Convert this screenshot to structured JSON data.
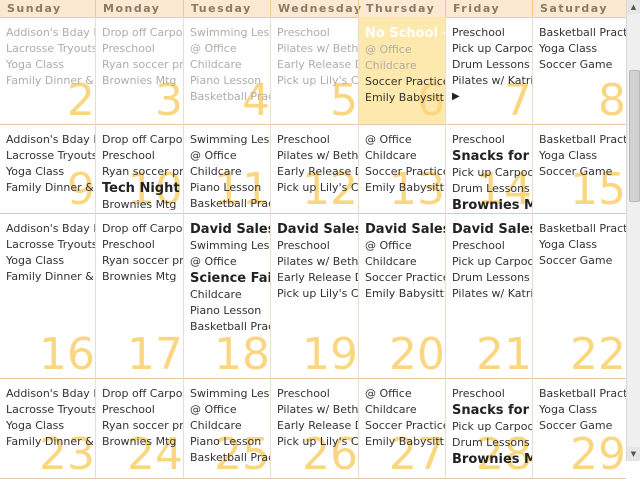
{
  "days_of_week": [
    "Sunday",
    "Monday",
    "Tuesday",
    "Wednesday",
    "Thursday",
    "Friday",
    "Saturday"
  ],
  "weeks": [
    {
      "days": [
        {
          "num": "2",
          "events": [
            {
              "text": "Addison's Bday P",
              "style": "past"
            },
            {
              "text": "Lacrosse Tryouts",
              "style": "past"
            },
            {
              "text": "Yoga Class",
              "style": "past"
            },
            {
              "text": "Family Dinner & M",
              "style": "past"
            }
          ]
        },
        {
          "num": "3",
          "events": [
            {
              "text": "Drop off Carpool",
              "style": "past"
            },
            {
              "text": "Preschool",
              "style": "past"
            },
            {
              "text": "Ryan soccer pra",
              "style": "past"
            },
            {
              "text": "Brownies Mtg",
              "style": "past"
            }
          ]
        },
        {
          "num": "4",
          "events": [
            {
              "text": "Swimming Lesso",
              "style": "past"
            },
            {
              "text": "@ Office",
              "style": "past"
            },
            {
              "text": "Childcare",
              "style": "past"
            },
            {
              "text": "Piano Lesson",
              "style": "past"
            },
            {
              "text": "Basketball Pract",
              "style": "past"
            }
          ]
        },
        {
          "num": "5",
          "events": [
            {
              "text": "Preschool",
              "style": "past"
            },
            {
              "text": "Pilates w/ Beth",
              "style": "past"
            },
            {
              "text": "Early Release D",
              "style": "past"
            },
            {
              "text": "Pick up Lily's Ca",
              "style": "past"
            }
          ]
        },
        {
          "num": "6",
          "today": true,
          "events": [
            {
              "text": "No School - ",
              "style": "bigwhite"
            },
            {
              "text": "@ Office",
              "style": "past"
            },
            {
              "text": "Childcare",
              "style": "past"
            },
            {
              "text": "Soccer Practice",
              "style": "normal"
            },
            {
              "text": "Emily Babysittin",
              "style": "normal"
            }
          ]
        },
        {
          "num": "7",
          "more": "▶",
          "events": [
            {
              "text": "Preschool",
              "style": "normal"
            },
            {
              "text": "Pick up Carpool",
              "style": "normal"
            },
            {
              "text": "Drum Lessons",
              "style": "normal"
            },
            {
              "text": "Pilates w/ Katrin",
              "style": "normal"
            }
          ]
        },
        {
          "num": "8",
          "events": [
            {
              "text": "Basketball Practic",
              "style": "normal"
            },
            {
              "text": "Yoga Class",
              "style": "normal"
            },
            {
              "text": "Soccer Game",
              "style": "normal"
            }
          ]
        }
      ]
    },
    {
      "days": [
        {
          "num": "9",
          "events": [
            {
              "text": "Addison's Bday P",
              "style": "normal"
            },
            {
              "text": "Lacrosse Tryouts",
              "style": "normal"
            },
            {
              "text": "Yoga Class",
              "style": "normal"
            },
            {
              "text": "Family Dinner & M",
              "style": "normal"
            }
          ]
        },
        {
          "num": "10",
          "events": [
            {
              "text": "Drop off Carpool",
              "style": "normal"
            },
            {
              "text": "Preschool",
              "style": "normal"
            },
            {
              "text": "Ryan soccer pra",
              "style": "normal"
            },
            {
              "text": "Tech Night",
              "style": "big"
            },
            {
              "text": "Brownies Mtg",
              "style": "normal"
            }
          ]
        },
        {
          "num": "11",
          "events": [
            {
              "text": "Swimming Lesso",
              "style": "normal"
            },
            {
              "text": "@ Office",
              "style": "normal"
            },
            {
              "text": "Childcare",
              "style": "normal"
            },
            {
              "text": "Piano Lesson",
              "style": "normal"
            },
            {
              "text": "Basketball Pract",
              "style": "normal"
            }
          ]
        },
        {
          "num": "12",
          "events": [
            {
              "text": "Preschool",
              "style": "normal"
            },
            {
              "text": "Pilates w/ Beth",
              "style": "normal"
            },
            {
              "text": "Early Release D",
              "style": "normal"
            },
            {
              "text": "Pick up Lily's Ca",
              "style": "normal"
            }
          ]
        },
        {
          "num": "13",
          "events": [
            {
              "text": "@ Office",
              "style": "normal"
            },
            {
              "text": "Childcare",
              "style": "normal"
            },
            {
              "text": "Soccer Practice",
              "style": "normal"
            },
            {
              "text": "Emily Babysittin",
              "style": "normal"
            }
          ]
        },
        {
          "num": "14",
          "events": [
            {
              "text": "Preschool",
              "style": "normal"
            },
            {
              "text": "Snacks for E",
              "style": "big"
            },
            {
              "text": "Pick up Carpool",
              "style": "normal"
            },
            {
              "text": "Drum Lessons",
              "style": "normal"
            },
            {
              "text": "Brownies Mtg",
              "style": "big"
            },
            {
              "text": "Pilates w/ Katrin",
              "style": "normal"
            }
          ]
        },
        {
          "num": "15",
          "events": [
            {
              "text": "Basketball Practic",
              "style": "normal"
            },
            {
              "text": "Yoga Class",
              "style": "normal"
            },
            {
              "text": "Soccer Game",
              "style": "normal"
            }
          ]
        }
      ]
    },
    {
      "days": [
        {
          "num": "16",
          "events": [
            {
              "text": "Addison's Bday P",
              "style": "normal"
            },
            {
              "text": "Lacrosse Tryouts",
              "style": "normal"
            },
            {
              "text": "Yoga Class",
              "style": "normal"
            },
            {
              "text": "Family Dinner & M",
              "style": "normal"
            }
          ]
        },
        {
          "num": "17",
          "events": [
            {
              "text": "Drop off Carpool",
              "style": "normal"
            },
            {
              "text": "Preschool",
              "style": "normal"
            },
            {
              "text": "Ryan soccer pra",
              "style": "normal"
            },
            {
              "text": "Brownies Mtg",
              "style": "normal"
            }
          ]
        },
        {
          "num": "18",
          "events": [
            {
              "text": "David Sales",
              "style": "big"
            },
            {
              "text": "Swimming Lesso",
              "style": "normal"
            },
            {
              "text": "@ Office",
              "style": "normal"
            },
            {
              "text": "Science Fair",
              "style": "big"
            },
            {
              "text": "Childcare",
              "style": "normal"
            },
            {
              "text": "Piano Lesson",
              "style": "normal"
            },
            {
              "text": "Basketball Pract",
              "style": "normal"
            }
          ]
        },
        {
          "num": "19",
          "events": [
            {
              "text": "David Sales",
              "style": "big"
            },
            {
              "text": "Preschool",
              "style": "normal"
            },
            {
              "text": "Pilates w/ Beth",
              "style": "normal"
            },
            {
              "text": "Early Release D",
              "style": "normal"
            },
            {
              "text": "Pick up Lily's Ca",
              "style": "normal"
            }
          ]
        },
        {
          "num": "20",
          "events": [
            {
              "text": "David Sales",
              "style": "big"
            },
            {
              "text": "@ Office",
              "style": "normal"
            },
            {
              "text": "Childcare",
              "style": "normal"
            },
            {
              "text": "Soccer Practice",
              "style": "normal"
            },
            {
              "text": "Emily Babysittin",
              "style": "normal"
            }
          ]
        },
        {
          "num": "21",
          "events": [
            {
              "text": "David Sales",
              "style": "big"
            },
            {
              "text": "Preschool",
              "style": "normal"
            },
            {
              "text": "Pick up Carpool",
              "style": "normal"
            },
            {
              "text": "Drum Lessons",
              "style": "normal"
            },
            {
              "text": "Pilates w/ Katrin",
              "style": "normal"
            }
          ]
        },
        {
          "num": "22",
          "events": [
            {
              "text": "Basketball Practic",
              "style": "normal"
            },
            {
              "text": "Yoga Class",
              "style": "normal"
            },
            {
              "text": "Soccer Game",
              "style": "normal"
            }
          ]
        }
      ]
    },
    {
      "days": [
        {
          "num": "23",
          "events": [
            {
              "text": "Addison's Bday P",
              "style": "normal"
            },
            {
              "text": "Lacrosse Tryouts",
              "style": "normal"
            },
            {
              "text": "Yoga Class",
              "style": "normal"
            },
            {
              "text": "Family Dinner & M",
              "style": "normal"
            }
          ]
        },
        {
          "num": "24",
          "events": [
            {
              "text": "Drop off Carpool",
              "style": "normal"
            },
            {
              "text": "Preschool",
              "style": "normal"
            },
            {
              "text": "Ryan soccer pra",
              "style": "normal"
            },
            {
              "text": "Brownies Mtg",
              "style": "normal"
            }
          ]
        },
        {
          "num": "25",
          "events": [
            {
              "text": "Swimming Lesso",
              "style": "normal"
            },
            {
              "text": "@ Office",
              "style": "normal"
            },
            {
              "text": "Childcare",
              "style": "normal"
            },
            {
              "text": "Piano Lesson",
              "style": "normal"
            },
            {
              "text": "Basketball Pract",
              "style": "normal"
            }
          ]
        },
        {
          "num": "26",
          "events": [
            {
              "text": "Preschool",
              "style": "normal"
            },
            {
              "text": "Pilates w/ Beth",
              "style": "normal"
            },
            {
              "text": "Early Release D",
              "style": "normal"
            },
            {
              "text": "Pick up Lily's Ca",
              "style": "normal"
            }
          ]
        },
        {
          "num": "27",
          "events": [
            {
              "text": "@ Office",
              "style": "normal"
            },
            {
              "text": "Childcare",
              "style": "normal"
            },
            {
              "text": "Soccer Practice",
              "style": "normal"
            },
            {
              "text": "Emily Babysittin",
              "style": "normal"
            }
          ]
        },
        {
          "num": "28",
          "events": [
            {
              "text": "Preschool",
              "style": "normal"
            },
            {
              "text": "Snacks for E",
              "style": "big"
            },
            {
              "text": "Pick up Carpool",
              "style": "normal"
            },
            {
              "text": "Drum Lessons",
              "style": "normal"
            },
            {
              "text": "Brownies Mt",
              "style": "big"
            }
          ]
        },
        {
          "num": "29",
          "events": [
            {
              "text": "Basketball Practic",
              "style": "normal"
            },
            {
              "text": "Yoga Class",
              "style": "normal"
            },
            {
              "text": "Soccer Game",
              "style": "normal"
            }
          ]
        }
      ]
    }
  ],
  "colors": {
    "header_bg": "#fce9d2",
    "today_bg": "#fde9ad",
    "day_number": "#fbd681",
    "past_text": "#b0aca8"
  },
  "icons": {
    "scroll_up": "scroll-up-arrow-icon",
    "scroll_down": "scroll-down-arrow-icon",
    "more": "more-events-arrow-icon"
  }
}
